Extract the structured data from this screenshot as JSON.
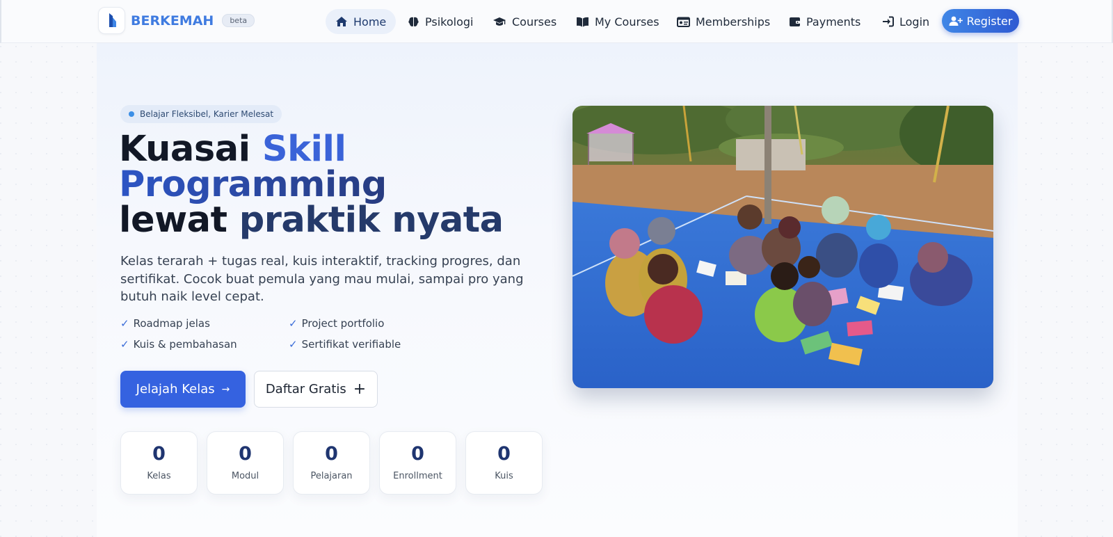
{
  "brand": {
    "name": "BERKEMAH",
    "badge": "beta"
  },
  "nav": {
    "items": [
      {
        "label": "Home",
        "icon": "home-icon",
        "active": true
      },
      {
        "label": "Psikologi",
        "icon": "brain-icon",
        "active": false
      },
      {
        "label": "Courses",
        "icon": "graduation-cap-icon",
        "active": false
      },
      {
        "label": "My Courses",
        "icon": "book-open-icon",
        "active": false
      },
      {
        "label": "Memberships",
        "icon": "id-card-icon",
        "active": false
      },
      {
        "label": "Payments",
        "icon": "wallet-icon",
        "active": false
      },
      {
        "label": "Login",
        "icon": "sign-in-icon",
        "active": false
      }
    ],
    "register_label": "Register"
  },
  "hero": {
    "badge": "Belajar Fleksibel, Karier Melesat",
    "title": {
      "part1": "Kuasai",
      "part2": "Skill",
      "part3": "Programming",
      "part4": "lewat",
      "part5": "praktik nyata"
    },
    "description": "Kelas terarah + tugas real, kuis interaktif, tracking progres, dan sertifikat. Cocok buat pemula yang mau mulai, sampai pro yang butuh naik level cepat.",
    "features": [
      "Roadmap jelas",
      "Project portfolio",
      "Kuis & pembahasan",
      "Sertifikat verifiable"
    ],
    "primary_button": "Jelajah Kelas",
    "secondary_button": "Daftar Gratis"
  },
  "stats": [
    {
      "value": "0",
      "label": "Kelas"
    },
    {
      "value": "0",
      "label": "Modul"
    },
    {
      "value": "0",
      "label": "Pelajaran"
    },
    {
      "value": "0",
      "label": "Enrollment"
    },
    {
      "value": "0",
      "label": "Kuis"
    }
  ],
  "colors": {
    "accent": "#3562e0",
    "brand": "#3f7be0",
    "heading": "#121826"
  }
}
